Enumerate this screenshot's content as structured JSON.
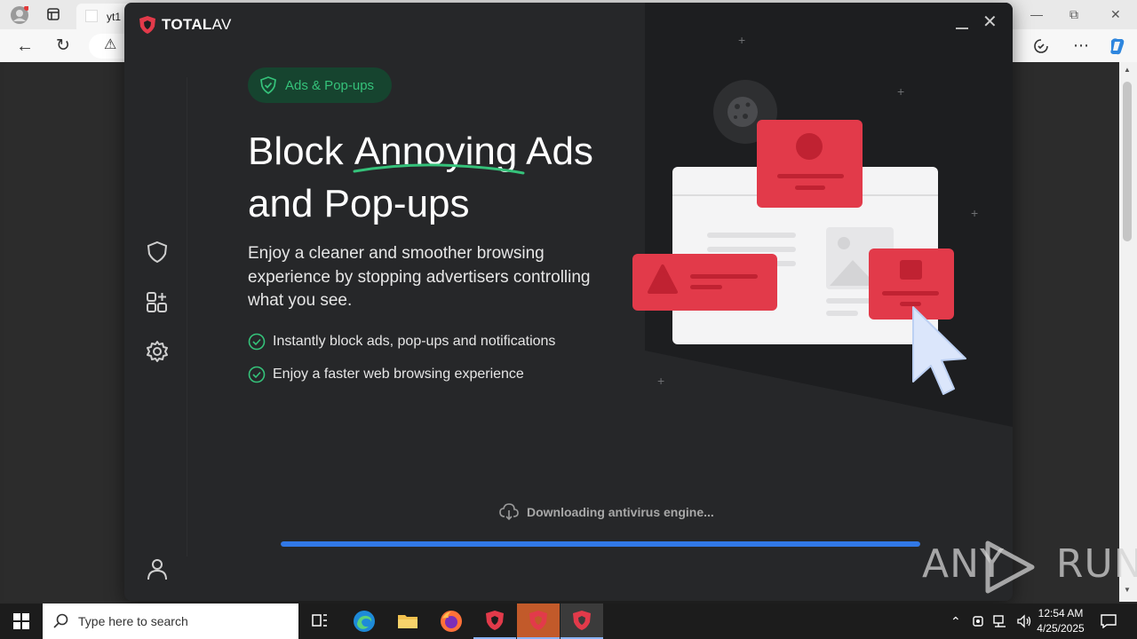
{
  "browser": {
    "tab_title": "yt1",
    "icons": [
      "profile-icon",
      "tab-actions-icon",
      "back-icon",
      "refresh-icon",
      "warning-icon",
      "minimize-icon",
      "restore-icon",
      "close-icon",
      "extensions-icon",
      "more-icon",
      "copilot-icon"
    ]
  },
  "app": {
    "brand": "TOTAL",
    "brand_suffix": "AV",
    "pill_label": "Ads & Pop-ups",
    "headline_part1": "Block ",
    "headline_highlight": "Annoying",
    "headline_part2": " Ads and Pop-ups",
    "subtitle": "Enjoy a cleaner and smoother browsing experience by stopping advertisers controlling what you see.",
    "features": [
      "Instantly block ads, pop-ups and notifications",
      "Enjoy a faster web browsing experience"
    ],
    "status": "Downloading antivirus engine...",
    "progress": 1.0,
    "colors": {
      "accent_green": "#35c27a",
      "ad_red": "#e23a4a",
      "progress_blue": "#3178e6"
    },
    "sidebar_icons": [
      "shield-icon",
      "apps-add-icon",
      "settings-icon",
      "account-icon"
    ]
  },
  "watermark": {
    "left": "ANY",
    "right": "RUN"
  },
  "taskbar": {
    "search_placeholder": "Type here to search",
    "time": "12:54 AM",
    "date": "4/25/2025"
  }
}
